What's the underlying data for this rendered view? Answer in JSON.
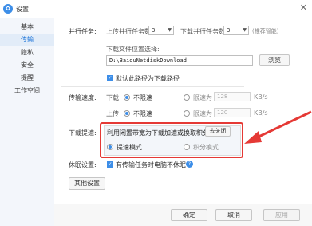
{
  "window": {
    "title": "设置",
    "app_icon_glyph": "✿",
    "close_glyph": "✕"
  },
  "sidebar": {
    "items": [
      {
        "label": "基本",
        "active": false
      },
      {
        "label": "传输",
        "active": true
      },
      {
        "label": "隐私",
        "active": false
      },
      {
        "label": "安全",
        "active": false
      },
      {
        "label": "提醒",
        "active": false
      },
      {
        "label": "工作空间",
        "active": false
      }
    ]
  },
  "parallel": {
    "section_label": "并行任务:",
    "upload_label": "上传并行任务数",
    "upload_value": "3",
    "download_label": "下载并行任务数",
    "download_value": "3",
    "hint": "(推荐智能)"
  },
  "download_location": {
    "label": "下载文件位置选择:",
    "path": "D:\\BaiduNetdiskDownload",
    "browse_label": "浏览",
    "default_checkbox_label": "默认此路径为下载路径",
    "default_checked": true
  },
  "speed": {
    "section_label": "传输速度:",
    "download_label": "下载",
    "upload_label": "上传",
    "unlimited_label": "不限速",
    "limit_label": "限速为",
    "download_limit_value": "128",
    "upload_limit_value": "120",
    "unit": "KB/s"
  },
  "boost": {
    "section_label": "下载提速:",
    "description": "利用闲置带宽为下载加速或换取积分",
    "toggle_label": "去关闭",
    "mode_speed_label": "提速模式",
    "mode_points_label": "积分模式",
    "selected_mode": "提速模式"
  },
  "sleep": {
    "section_label": "休眠设置:",
    "checkbox_label": "有传输任务时电脑不休眠",
    "checked": true,
    "help_glyph": "?"
  },
  "other_settings_label": "其他设置",
  "footer": {
    "ok_label": "确定",
    "cancel_label": "取消",
    "apply_label": "应用"
  },
  "colors": {
    "accent": "#3d8ee8",
    "annotation": "#e53935"
  }
}
